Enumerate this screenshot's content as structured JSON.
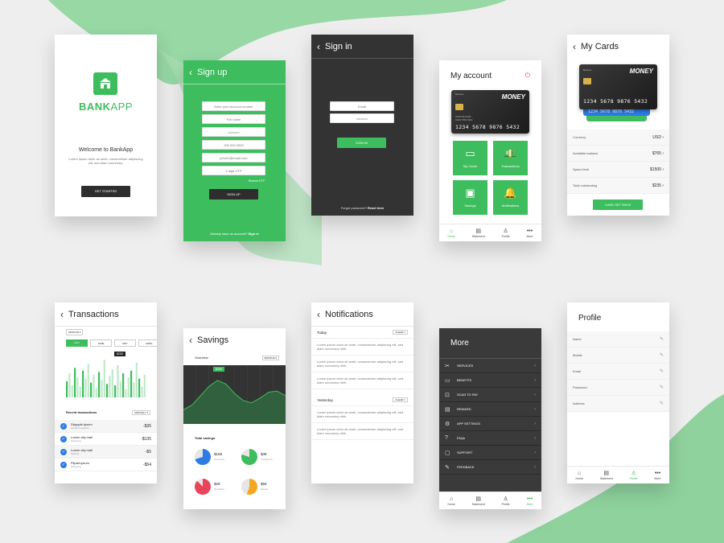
{
  "colors": {
    "green": "#3dbd5d",
    "dark": "#333333"
  },
  "welcome": {
    "logo_text_bank": "BANK",
    "logo_text_app": "APP",
    "title": "Welcome to BankApp",
    "body": "Lorem ipsum dolor sit amet, consectetuer adipiscing elit, sed diam nonummy.",
    "button": "GET STARTED"
  },
  "signup": {
    "title": "Sign up",
    "placeholders": [
      "Enter your account number",
      "Full name",
      "••••••••••",
      "000 000 0000",
      "john01@email.com",
      "4 digit OTP"
    ],
    "resend": "Resend OTP",
    "button": "SIGN UP",
    "footer_text": "Already have an account?",
    "footer_link": "Sign in"
  },
  "signin": {
    "title": "Sign in",
    "placeholders": [
      "Email",
      "••••••••••"
    ],
    "button": "SIGN IN",
    "footer_text": "Forgot password?",
    "footer_link": "Reset here"
  },
  "myaccount": {
    "title": "My account",
    "card": {
      "brand": "MONEY",
      "label": "Business",
      "number": "1234 5678 9876 5432",
      "holder": "JOHN WILLIAMS",
      "expiry": "VALID THRU 09/21"
    },
    "tiles": [
      {
        "label": "My Cards",
        "icon": "cards-icon"
      },
      {
        "label": "Transactions",
        "icon": "money-icon"
      },
      {
        "label": "Savings",
        "icon": "savings-icon"
      },
      {
        "label": "Notifications",
        "icon": "bell-icon"
      }
    ]
  },
  "nav": {
    "items": [
      {
        "label": "Home",
        "icon": "home-icon"
      },
      {
        "label": "Statement",
        "icon": "document-icon"
      },
      {
        "label": "Profile",
        "icon": "user-icon"
      },
      {
        "label": "More",
        "icon": "dots-icon"
      }
    ]
  },
  "mycards": {
    "title": "My Cards",
    "card": {
      "brand": "MONEY",
      "label": "Business",
      "number": "1234 5678 9876 5432"
    },
    "back_card_number": "1234 5678 9876 5432",
    "rows": [
      {
        "label": "Currency",
        "value": "USD"
      },
      {
        "label": "Available balance",
        "value": "$765"
      },
      {
        "label": "Spend limit",
        "value": "$1500"
      },
      {
        "label": "Total outstanding",
        "value": "$235"
      }
    ],
    "button": "CARD SETTINGS"
  },
  "transactions": {
    "title": "Transactions",
    "filter": "MONTHS",
    "months": [
      "JULY",
      "JUNE",
      "MAY",
      "APRIL"
    ],
    "tooltip": "$235",
    "section": "Recent transactions",
    "section_filter": "MONTHLY",
    "chart_data": {
      "type": "bar",
      "values": [
        12,
        18,
        9,
        22,
        15,
        8,
        20,
        14,
        25,
        11,
        17,
        7,
        19,
        13,
        28,
        10,
        16,
        21,
        9,
        24,
        12,
        18,
        6,
        15,
        20,
        11,
        26,
        14,
        8,
        17
      ]
    },
    "items": [
      {
        "name": "Drippple.ipsum",
        "sub": "Account upgrade",
        "amount": "-$35"
      },
      {
        "name": "Lorem city mall",
        "sub": "Shopping",
        "amount": "-$135"
      },
      {
        "name": "Lorem city mall",
        "sub": "Parking",
        "amount": "-$5"
      },
      {
        "name": "Flipart.ipsum",
        "sub": "Shopping",
        "amount": "-$54"
      }
    ]
  },
  "savings": {
    "title": "Savings",
    "overview": "Overview",
    "filter": "MONTHS",
    "tooltip": "$156",
    "total": "Total savings",
    "chart_data": {
      "type": "area",
      "values": [
        32,
        36,
        44,
        52,
        57,
        54,
        46,
        40,
        38,
        42,
        47,
        48,
        44
      ]
    },
    "items": [
      {
        "amount": "$168",
        "label": "Groceries",
        "pct": 0.3,
        "color": "#2d7be5"
      },
      {
        "amount": "$38",
        "label": "Investment",
        "pct": 0.2,
        "color": "#3dbd5d"
      },
      {
        "amount": "$28",
        "label": "Recharge",
        "pct": 0.12,
        "color": "#e8455a"
      },
      {
        "amount": "$55",
        "label": "Movies",
        "pct": 0.45,
        "color": "#f5a623"
      }
    ]
  },
  "notifications": {
    "title": "Notifications",
    "groups": [
      {
        "label": "Today",
        "action": "CLEAR",
        "items": [
          "Lorem ipsum dolor sit amet, consectetuer adipiscing elit, sed diam nonummy nibh.",
          "Lorem ipsum dolor sit amet, consectetuer adipiscing elit, sed diam nonummy nibh.",
          "Lorem ipsum dolor sit amet, consectetuer adipiscing elit, sed diam nonummy nibh."
        ]
      },
      {
        "label": "Yesterday",
        "action": "CLEAR",
        "items": [
          "Lorem ipsum dolor sit amet, consectetuer adipiscing elit, sed diam nonummy nibh.",
          "Lorem ipsum dolor sit amet, consectetuer adipiscing elit, sed diam nonummy nibh."
        ]
      }
    ]
  },
  "more": {
    "title": "More",
    "items": [
      {
        "label": "SERVICES",
        "icon": "tools-icon"
      },
      {
        "label": "BENIFITS",
        "icon": "ticket-icon"
      },
      {
        "label": "SCAN TO PAY",
        "icon": "scan-icon"
      },
      {
        "label": "REWARD",
        "icon": "gift-icon"
      },
      {
        "label": "APP SETTINGS",
        "icon": "gear-icon"
      },
      {
        "label": "FAQs",
        "icon": "help-icon"
      },
      {
        "label": "SUPPORT",
        "icon": "chat-icon"
      },
      {
        "label": "FEEDBACK",
        "icon": "feedback-icon"
      }
    ]
  },
  "profile": {
    "title": "Profile",
    "fields": [
      "Name",
      "Mobile",
      "Email",
      "Password",
      "Address"
    ]
  }
}
